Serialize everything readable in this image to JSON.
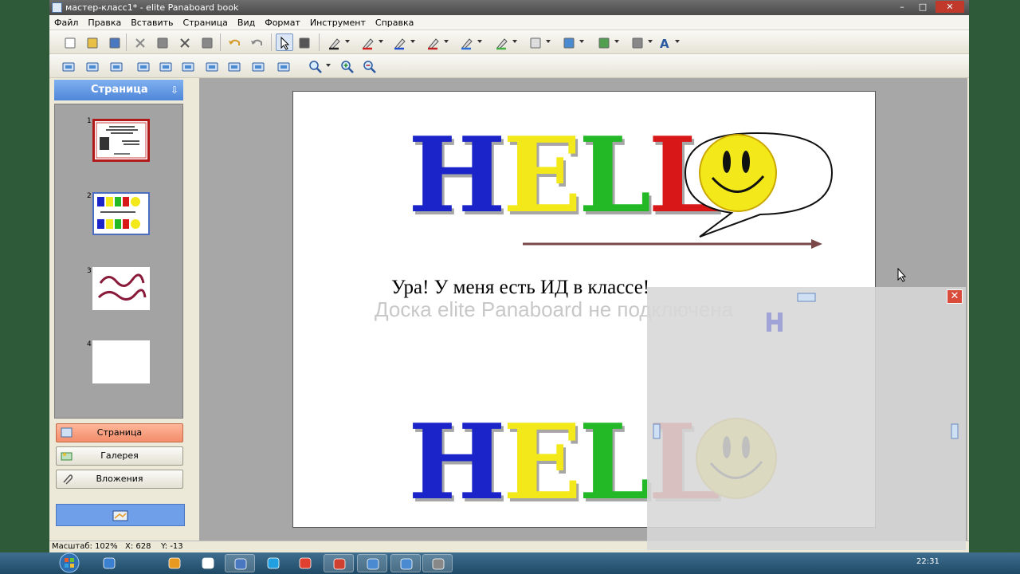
{
  "window": {
    "title": "мастер-класс1* - elite Panaboard book",
    "minimize": "–",
    "maximize": "□",
    "close": "✕"
  },
  "menu": [
    "Файл",
    "Правка",
    "Вставить",
    "Страница",
    "Вид",
    "Формат",
    "Инструмент",
    "Справка"
  ],
  "toolbar1": [
    {
      "name": "new-icon",
      "color": "#ffffff"
    },
    {
      "name": "open-icon",
      "color": "#e9c046"
    },
    {
      "name": "save-icon",
      "color": "#4a78c0"
    },
    {
      "name": "cut-icon",
      "color": "#888888"
    },
    {
      "name": "copy-icon",
      "color": "#888888"
    },
    {
      "name": "delete-icon",
      "color": "#555555"
    },
    {
      "name": "paste-icon",
      "color": "#888888"
    },
    {
      "name": "undo-icon",
      "color": "#d39c2a"
    },
    {
      "name": "redo-icon",
      "color": "#888888"
    },
    {
      "name": "select-icon",
      "color": "#333333"
    },
    {
      "name": "scissors-select-icon",
      "color": "#555555"
    },
    {
      "name": "pen-black-icon",
      "color": "#222222"
    },
    {
      "name": "pen-red-icon",
      "color": "#d02020"
    },
    {
      "name": "pen-blue-icon",
      "color": "#2050d0"
    },
    {
      "name": "pen-red2-icon",
      "color": "#c02020"
    },
    {
      "name": "marker-blue-icon",
      "color": "#2a6fd6"
    },
    {
      "name": "highlighter-green-icon",
      "color": "#40b040"
    },
    {
      "name": "eraser-icon",
      "color": "#dddddd"
    },
    {
      "name": "line-icon",
      "color": "#4a8ad0"
    },
    {
      "name": "shapes-icon",
      "color": "#50a050"
    },
    {
      "name": "arrange-icon",
      "color": "#888888"
    },
    {
      "name": "text-tool-icon",
      "color": "#2a5aa0"
    }
  ],
  "toolbar2": [
    {
      "name": "add-page-icon"
    },
    {
      "name": "prev-page-icon"
    },
    {
      "name": "next-page-icon"
    },
    {
      "name": "screen-capture-icon"
    },
    {
      "name": "camera-icon"
    },
    {
      "name": "window-capture-icon"
    },
    {
      "name": "screen-icon"
    },
    {
      "name": "keyboard-icon"
    },
    {
      "name": "stamp-icon"
    },
    {
      "name": "screen-mode-icon"
    },
    {
      "name": "zoom-icon"
    },
    {
      "name": "zoom-in-icon"
    },
    {
      "name": "zoom-out-icon"
    }
  ],
  "sidebar": {
    "title": "Страница",
    "pin": "⇩",
    "pages": [
      {
        "number": "1"
      },
      {
        "number": "2"
      },
      {
        "number": "3"
      },
      {
        "number": "4"
      }
    ],
    "nav": [
      {
        "label": "Страница",
        "active": true
      },
      {
        "label": "Галерея",
        "active": false
      },
      {
        "label": "Вложения",
        "active": false
      }
    ]
  },
  "page": {
    "hello_letters": [
      {
        "ch": "H",
        "color": "#1a24c8"
      },
      {
        "ch": "E",
        "color": "#f2e81a"
      },
      {
        "ch": "L",
        "color": "#22b826"
      },
      {
        "ch": "L",
        "color": "#d81818"
      }
    ],
    "caption": "Ура! У меня есть ИД в классе!",
    "ghost_text": "Доска elite Panaboard не подключена"
  },
  "statusbar": {
    "zoom": "Масштаб: 102%",
    "x": "X: 628",
    "y": "Y: -13"
  },
  "overlay": {
    "close": "✕"
  },
  "taskbar": {
    "clock": "22:31",
    "items": [
      {
        "name": "ie-icon",
        "color": "#3a7fd0"
      },
      {
        "name": "media-player-icon",
        "color": "#e89a20"
      },
      {
        "name": "shield-icon",
        "color": "#ffffff"
      },
      {
        "name": "explorer-save-icon",
        "color": "#4a78c0"
      },
      {
        "name": "skype-icon",
        "color": "#20a0e0"
      },
      {
        "name": "chrome-icon",
        "color": "#e04030"
      },
      {
        "name": "presentation-icon",
        "color": "#d04030"
      },
      {
        "name": "panaboard-icon",
        "color": "#4a8ad0"
      },
      {
        "name": "panaboard-book-icon",
        "color": "#4a8ad0"
      },
      {
        "name": "app-window-icon",
        "color": "#888888"
      }
    ]
  }
}
